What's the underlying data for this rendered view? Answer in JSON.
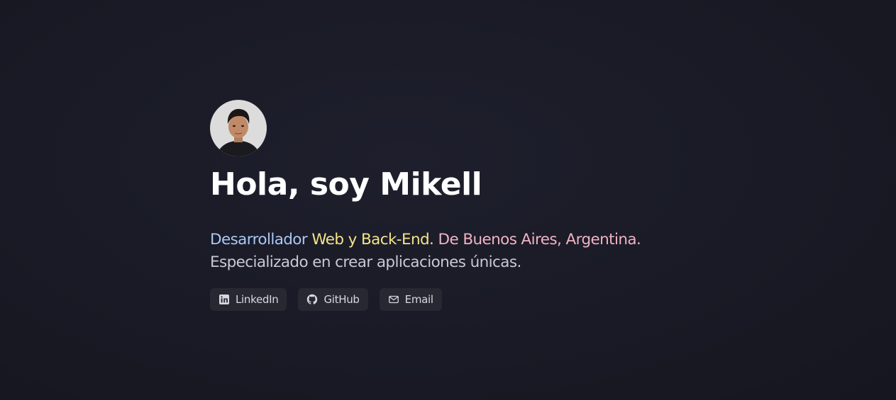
{
  "profile": {
    "avatar_icon": "avatar-photo",
    "title": "Hola, soy Mikell"
  },
  "description": {
    "part_role": "Desarrollador",
    "part_stack": "Web y Back-End.",
    "part_location": "De Buenos Aires, Argentina.",
    "line2": "Especializado en crear aplicaciones únicas."
  },
  "links": [
    {
      "label": "LinkedIn",
      "icon": "linkedin-icon"
    },
    {
      "label": "GitHub",
      "icon": "github-icon"
    },
    {
      "label": "Email",
      "icon": "mail-icon"
    }
  ],
  "colors": {
    "background": "#1a1b27",
    "title": "#ffffff",
    "role": "#a9c8f5",
    "stack": "#f2e48a",
    "location": "#f1b3c4",
    "body_text": "#c8c9d1",
    "pill_bg": "#282833"
  }
}
